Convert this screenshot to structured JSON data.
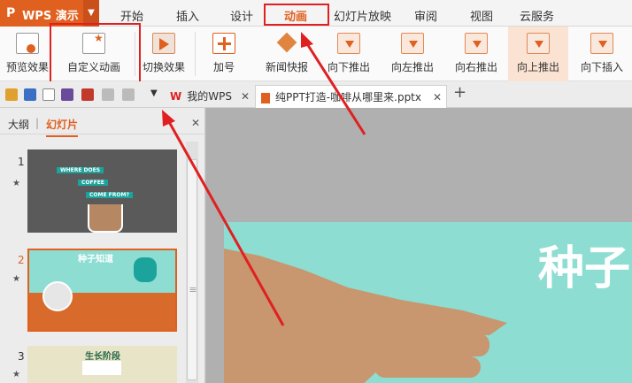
{
  "app": {
    "logo": "P",
    "name": "WPS 演示"
  },
  "menu_tabs": [
    "开始",
    "插入",
    "设计",
    "动画",
    "幻灯片放映",
    "审阅",
    "视图",
    "云服务"
  ],
  "ribbon_buttons": [
    "预览效果",
    "自定义动画",
    "切换效果",
    "加号",
    "新闻快报",
    "向下推出",
    "向左推出",
    "向右推出",
    "向上推出",
    "向下插入"
  ],
  "doc_tabs": {
    "home": "我的WPS",
    "file": "纯PPT打造-咖啡从哪里来.pptx",
    "add": "+"
  },
  "sidebar": {
    "tab_outline": "大纲",
    "tab_slides": "幻灯片",
    "close": "✕"
  },
  "slides": [
    {
      "num": "1",
      "lines": [
        "WHERE DOES",
        "COFFEE",
        "COME FROM?"
      ]
    },
    {
      "num": "2",
      "title": "种子知道"
    },
    {
      "num": "3",
      "title": "生长阶段"
    }
  ],
  "slide_title": "种子",
  "colors": {
    "accent": "#e0601f",
    "highlight": "#e02020",
    "slide_bg": "#8dddd2"
  }
}
